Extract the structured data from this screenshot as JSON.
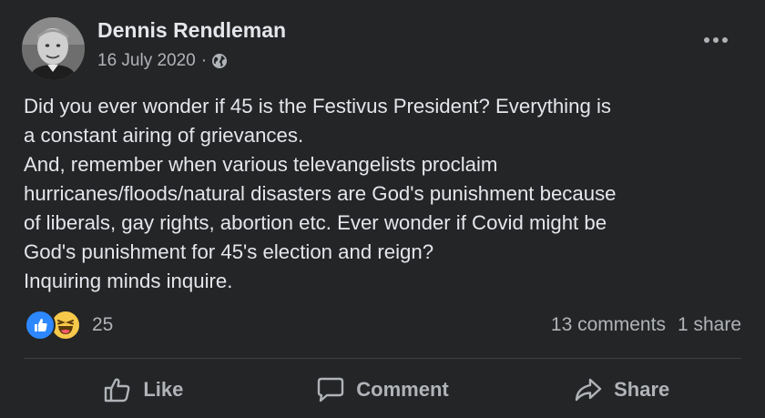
{
  "post": {
    "author": "Dennis Rendleman",
    "date": "16 July 2020",
    "separator": "·",
    "audience_icon": "globe-icon",
    "more_icon": "more-options-icon",
    "text_lines": [
      "Did you ever wonder if 45 is the Festivus President?  Everything is",
      "a constant airing of grievances.",
      "And, remember when various televangelists proclaim",
      "hurricanes/floods/natural disasters are God's punishment because",
      "of liberals, gay rights, abortion etc.  Ever wonder if Covid might be",
      "God's punishment for 45's election and reign?",
      "Inquiring minds inquire."
    ]
  },
  "reactions": {
    "icons": [
      "like-reaction-icon",
      "haha-reaction-icon"
    ],
    "count": "25"
  },
  "stats": {
    "comments": "13 comments",
    "shares": "1 share"
  },
  "actions": {
    "like": "Like",
    "comment": "Comment",
    "share": "Share"
  },
  "colors": {
    "background": "#242526",
    "primary_text": "#e4e6eb",
    "secondary_text": "#b0b3b8",
    "divider": "#3e4042",
    "like_blue": "#2d88ff",
    "haha_yellow": "#f7c94b"
  }
}
